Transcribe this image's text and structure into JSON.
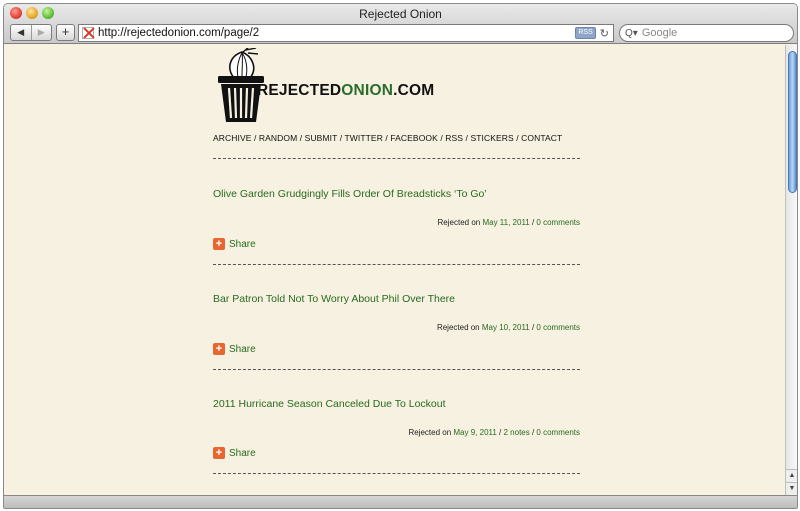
{
  "window": {
    "title": "Rejected Onion"
  },
  "toolbar": {
    "back_label": "◀",
    "forward_label": "▶",
    "add_label": "+",
    "url": "http://rejectedonion.com/page/2",
    "rss_label": "RSS",
    "reload_label": "↻",
    "search_placeholder": "Google",
    "search_icon_glyph": "Q▾"
  },
  "site": {
    "logo_text_black": "REJECTED",
    "logo_text_green": "ONION",
    "logo_text_suffix": ".COM",
    "nav": [
      "ARCHIVE",
      "RANDOM",
      "SUBMIT",
      "TWITTER",
      "FACEBOOK",
      "RSS",
      "STICKERS",
      "CONTACT"
    ],
    "nav_separator": " / "
  },
  "posts": [
    {
      "title": "Olive Garden Grudgingly Fills Order Of Breadsticks ‘To Go’",
      "meta_prefix": "Rejected on ",
      "date": "May 11, 2011",
      "sep": " / ",
      "notes": "",
      "comments": "0 comments",
      "share": "Share"
    },
    {
      "title": "Bar Patron Told Not To Worry About Phil Over There",
      "meta_prefix": "Rejected on ",
      "date": "May 10, 2011",
      "sep": " / ",
      "notes": "",
      "comments": "0 comments",
      "share": "Share"
    },
    {
      "title": "2011 Hurricane Season Canceled Due To Lockout",
      "meta_prefix": "Rejected on ",
      "date": "May 9, 2011",
      "sep": " / ",
      "notes": "2 notes",
      "comments": "0 comments",
      "share": "Share"
    }
  ],
  "colors": {
    "link_green": "#2a6a1e",
    "page_bg": "#f6f1e1",
    "share_orange": "#e8662f"
  }
}
